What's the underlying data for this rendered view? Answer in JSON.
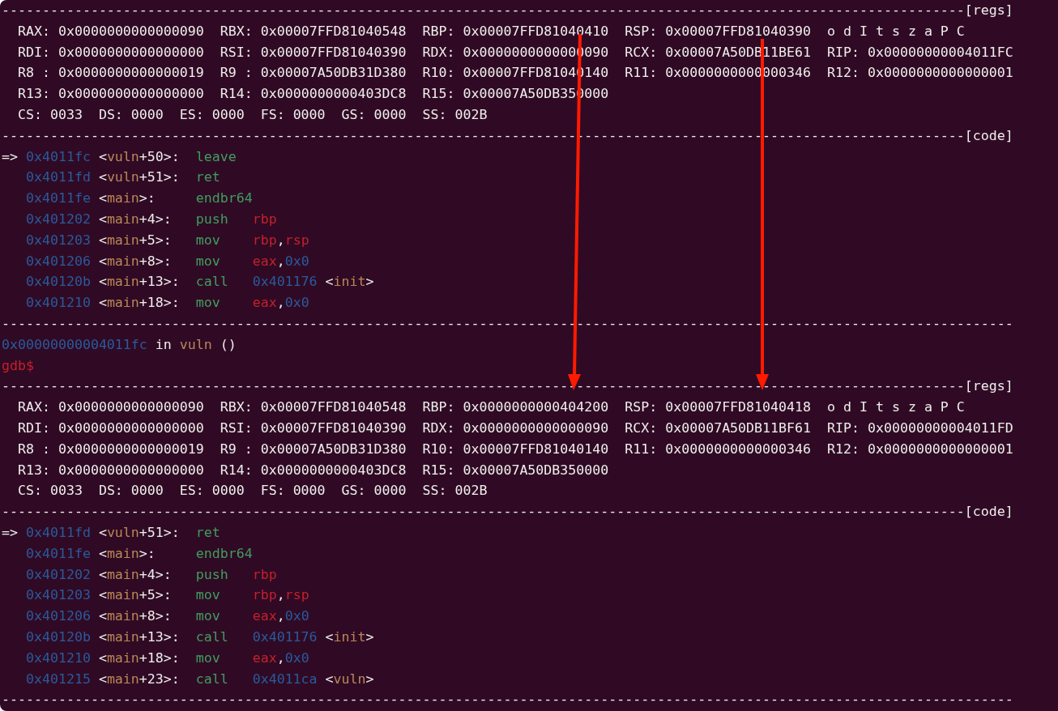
{
  "terminal": {
    "blocks": [
      {
        "kind": "separator",
        "text": "-----------------------------------------------------------------------------------------------------------------------[regs]"
      },
      {
        "kind": "regs",
        "rows": [
          {
            "registers": [
              {
                "label": "RAX:",
                "value": "0x0000000000000090"
              },
              {
                "label": "RBX:",
                "value": "0x00007FFD81040548"
              },
              {
                "label": "RBP:",
                "value": "0x00007FFD81040410"
              },
              {
                "label": "RSP:",
                "value": "0x00007FFD81040390"
              }
            ],
            "flags": "o d I t s z a P C"
          },
          {
            "registers": [
              {
                "label": "RDI:",
                "value": "0x0000000000000000"
              },
              {
                "label": "RSI:",
                "value": "0x00007FFD81040390"
              },
              {
                "label": "RDX:",
                "value": "0x0000000000000090"
              },
              {
                "label": "RCX:",
                "value": "0x00007A50DB11BE61"
              },
              {
                "label": "RIP:",
                "value": "0x00000000004011FC"
              }
            ]
          },
          {
            "registers": [
              {
                "label": "R8 :",
                "value": "0x0000000000000019"
              },
              {
                "label": "R9 :",
                "value": "0x00007A50DB31D380"
              },
              {
                "label": "R10:",
                "value": "0x00007FFD81040140"
              },
              {
                "label": "R11:",
                "value": "0x0000000000000346"
              },
              {
                "label": "R12:",
                "value": "0x0000000000000001"
              }
            ]
          },
          {
            "registers": [
              {
                "label": "R13:",
                "value": "0x0000000000000000"
              },
              {
                "label": "R14:",
                "value": "0x0000000000403DC8"
              },
              {
                "label": "R15:",
                "value": "0x00007A50DB350000"
              }
            ]
          }
        ]
      },
      {
        "kind": "segments",
        "registers": [
          {
            "label": "CS:",
            "value": "0033"
          },
          {
            "label": "DS:",
            "value": "0000"
          },
          {
            "label": "ES:",
            "value": "0000"
          },
          {
            "label": "FS:",
            "value": "0000"
          },
          {
            "label": "GS:",
            "value": "0000"
          },
          {
            "label": "SS:",
            "value": "002B"
          }
        ]
      },
      {
        "kind": "separator",
        "text": "-----------------------------------------------------------------------------------------------------------------------[code]"
      },
      {
        "kind": "code",
        "lines": [
          {
            "marker": "=>",
            "address": "0x4011fc",
            "symbol": [
              {
                "kind": "punct",
                "text": "<"
              },
              {
                "kind": "name",
                "text": "vuln"
              },
              {
                "kind": "punct",
                "text": "+50>:"
              }
            ],
            "mnemonic": "leave"
          },
          {
            "address": "0x4011fd",
            "symbol": [
              {
                "kind": "punct",
                "text": "<"
              },
              {
                "kind": "name",
                "text": "vuln"
              },
              {
                "kind": "punct",
                "text": "+51>:"
              }
            ],
            "mnemonic": "ret"
          },
          {
            "address": "0x4011fe",
            "symbol": [
              {
                "kind": "punct",
                "text": "<"
              },
              {
                "kind": "name",
                "text": "main"
              },
              {
                "kind": "punct",
                "text": ">:"
              }
            ],
            "mnemonic": "endbr64"
          },
          {
            "address": "0x401202",
            "symbol": [
              {
                "kind": "punct",
                "text": "<"
              },
              {
                "kind": "name",
                "text": "main"
              },
              {
                "kind": "punct",
                "text": "+4>:"
              }
            ],
            "mnemonic": "push",
            "operands": [
              {
                "kind": "register",
                "text": "rbp"
              }
            ]
          },
          {
            "address": "0x401203",
            "symbol": [
              {
                "kind": "punct",
                "text": "<"
              },
              {
                "kind": "name",
                "text": "main"
              },
              {
                "kind": "punct",
                "text": "+5>:"
              }
            ],
            "mnemonic": "mov",
            "operands": [
              {
                "kind": "register",
                "text": "rbp"
              },
              {
                "kind": "punct",
                "text": ","
              },
              {
                "kind": "register",
                "text": "rsp"
              }
            ]
          },
          {
            "address": "0x401206",
            "symbol": [
              {
                "kind": "punct",
                "text": "<"
              },
              {
                "kind": "name",
                "text": "main"
              },
              {
                "kind": "punct",
                "text": "+8>:"
              }
            ],
            "mnemonic": "mov",
            "operands": [
              {
                "kind": "register",
                "text": "eax"
              },
              {
                "kind": "punct",
                "text": ","
              },
              {
                "kind": "number",
                "text": "0x0"
              }
            ]
          },
          {
            "address": "0x40120b",
            "symbol": [
              {
                "kind": "punct",
                "text": "<"
              },
              {
                "kind": "name",
                "text": "main"
              },
              {
                "kind": "punct",
                "text": "+13>:"
              }
            ],
            "mnemonic": "call",
            "operands": [
              {
                "kind": "number",
                "text": "0x401176"
              }
            ],
            "target": [
              {
                "kind": "punct",
                "text": "<"
              },
              {
                "kind": "name",
                "text": "init"
              },
              {
                "kind": "punct",
                "text": ">"
              }
            ]
          },
          {
            "address": "0x401210",
            "symbol": [
              {
                "kind": "punct",
                "text": "<"
              },
              {
                "kind": "name",
                "text": "main"
              },
              {
                "kind": "punct",
                "text": "+18>:"
              }
            ],
            "mnemonic": "mov",
            "operands": [
              {
                "kind": "register",
                "text": "eax"
              },
              {
                "kind": "punct",
                "text": ","
              },
              {
                "kind": "number",
                "text": "0x0"
              }
            ]
          }
        ]
      },
      {
        "kind": "separator",
        "text": "-----------------------------------------------------------------------------------------------------------------------------"
      },
      {
        "kind": "frame",
        "address": "0x00000000004011fc",
        "word": "in",
        "function": "vuln",
        "args": "()"
      },
      {
        "kind": "prompt",
        "text": "gdb$"
      },
      {
        "kind": "separator",
        "text": "-----------------------------------------------------------------------------------------------------------------------[regs]"
      },
      {
        "kind": "regs",
        "rows": [
          {
            "registers": [
              {
                "label": "RAX:",
                "value": "0x0000000000000090"
              },
              {
                "label": "RBX:",
                "value": "0x00007FFD81040548"
              },
              {
                "label": "RBP:",
                "value": "0x0000000000404200"
              },
              {
                "label": "RSP:",
                "value": "0x00007FFD81040418"
              }
            ],
            "flags": "o d I t s z a P C"
          },
          {
            "registers": [
              {
                "label": "RDI:",
                "value": "0x0000000000000000"
              },
              {
                "label": "RSI:",
                "value": "0x00007FFD81040390"
              },
              {
                "label": "RDX:",
                "value": "0x0000000000000090"
              },
              {
                "label": "RCX:",
                "value": "0x00007A50DB11BF61"
              },
              {
                "label": "RIP:",
                "value": "0x00000000004011FD"
              }
            ]
          },
          {
            "registers": [
              {
                "label": "R8 :",
                "value": "0x0000000000000019"
              },
              {
                "label": "R9 :",
                "value": "0x00007A50DB31D380"
              },
              {
                "label": "R10:",
                "value": "0x00007FFD81040140"
              },
              {
                "label": "R11:",
                "value": "0x0000000000000346"
              },
              {
                "label": "R12:",
                "value": "0x0000000000000001"
              }
            ]
          },
          {
            "registers": [
              {
                "label": "R13:",
                "value": "0x0000000000000000"
              },
              {
                "label": "R14:",
                "value": "0x0000000000403DC8"
              },
              {
                "label": "R15:",
                "value": "0x00007A50DB350000"
              }
            ]
          }
        ]
      },
      {
        "kind": "segments",
        "registers": [
          {
            "label": "CS:",
            "value": "0033"
          },
          {
            "label": "DS:",
            "value": "0000"
          },
          {
            "label": "ES:",
            "value": "0000"
          },
          {
            "label": "FS:",
            "value": "0000"
          },
          {
            "label": "GS:",
            "value": "0000"
          },
          {
            "label": "SS:",
            "value": "002B"
          }
        ]
      },
      {
        "kind": "separator",
        "text": "-----------------------------------------------------------------------------------------------------------------------[code]"
      },
      {
        "kind": "code",
        "lines": [
          {
            "marker": "=>",
            "address": "0x4011fd",
            "symbol": [
              {
                "kind": "punct",
                "text": "<"
              },
              {
                "kind": "name",
                "text": "vuln"
              },
              {
                "kind": "punct",
                "text": "+51>:"
              }
            ],
            "mnemonic": "ret"
          },
          {
            "address": "0x4011fe",
            "symbol": [
              {
                "kind": "punct",
                "text": "<"
              },
              {
                "kind": "name",
                "text": "main"
              },
              {
                "kind": "punct",
                "text": ">:"
              }
            ],
            "mnemonic": "endbr64"
          },
          {
            "address": "0x401202",
            "symbol": [
              {
                "kind": "punct",
                "text": "<"
              },
              {
                "kind": "name",
                "text": "main"
              },
              {
                "kind": "punct",
                "text": "+4>:"
              }
            ],
            "mnemonic": "push",
            "operands": [
              {
                "kind": "register",
                "text": "rbp"
              }
            ]
          },
          {
            "address": "0x401203",
            "symbol": [
              {
                "kind": "punct",
                "text": "<"
              },
              {
                "kind": "name",
                "text": "main"
              },
              {
                "kind": "punct",
                "text": "+5>:"
              }
            ],
            "mnemonic": "mov",
            "operands": [
              {
                "kind": "register",
                "text": "rbp"
              },
              {
                "kind": "punct",
                "text": ","
              },
              {
                "kind": "register",
                "text": "rsp"
              }
            ]
          },
          {
            "address": "0x401206",
            "symbol": [
              {
                "kind": "punct",
                "text": "<"
              },
              {
                "kind": "name",
                "text": "main"
              },
              {
                "kind": "punct",
                "text": "+8>:"
              }
            ],
            "mnemonic": "mov",
            "operands": [
              {
                "kind": "register",
                "text": "eax"
              },
              {
                "kind": "punct",
                "text": ","
              },
              {
                "kind": "number",
                "text": "0x0"
              }
            ]
          },
          {
            "address": "0x40120b",
            "symbol": [
              {
                "kind": "punct",
                "text": "<"
              },
              {
                "kind": "name",
                "text": "main"
              },
              {
                "kind": "punct",
                "text": "+13>:"
              }
            ],
            "mnemonic": "call",
            "operands": [
              {
                "kind": "number",
                "text": "0x401176"
              }
            ],
            "target": [
              {
                "kind": "punct",
                "text": "<"
              },
              {
                "kind": "name",
                "text": "init"
              },
              {
                "kind": "punct",
                "text": ">"
              }
            ]
          },
          {
            "address": "0x401210",
            "symbol": [
              {
                "kind": "punct",
                "text": "<"
              },
              {
                "kind": "name",
                "text": "main"
              },
              {
                "kind": "punct",
                "text": "+18>:"
              }
            ],
            "mnemonic": "mov",
            "operands": [
              {
                "kind": "register",
                "text": "eax"
              },
              {
                "kind": "punct",
                "text": ","
              },
              {
                "kind": "number",
                "text": "0x0"
              }
            ]
          },
          {
            "address": "0x401215",
            "symbol": [
              {
                "kind": "punct",
                "text": "<"
              },
              {
                "kind": "name",
                "text": "main"
              },
              {
                "kind": "punct",
                "text": "+23>:"
              }
            ],
            "mnemonic": "call",
            "operands": [
              {
                "kind": "number",
                "text": "0x4011ca"
              }
            ],
            "target": [
              {
                "kind": "punct",
                "text": "<"
              },
              {
                "kind": "name",
                "text": "vuln"
              },
              {
                "kind": "punct",
                "text": ">"
              }
            ]
          }
        ]
      },
      {
        "kind": "separator",
        "text": "-----------------------------------------------------------------------------------------------------------------------------"
      }
    ]
  }
}
